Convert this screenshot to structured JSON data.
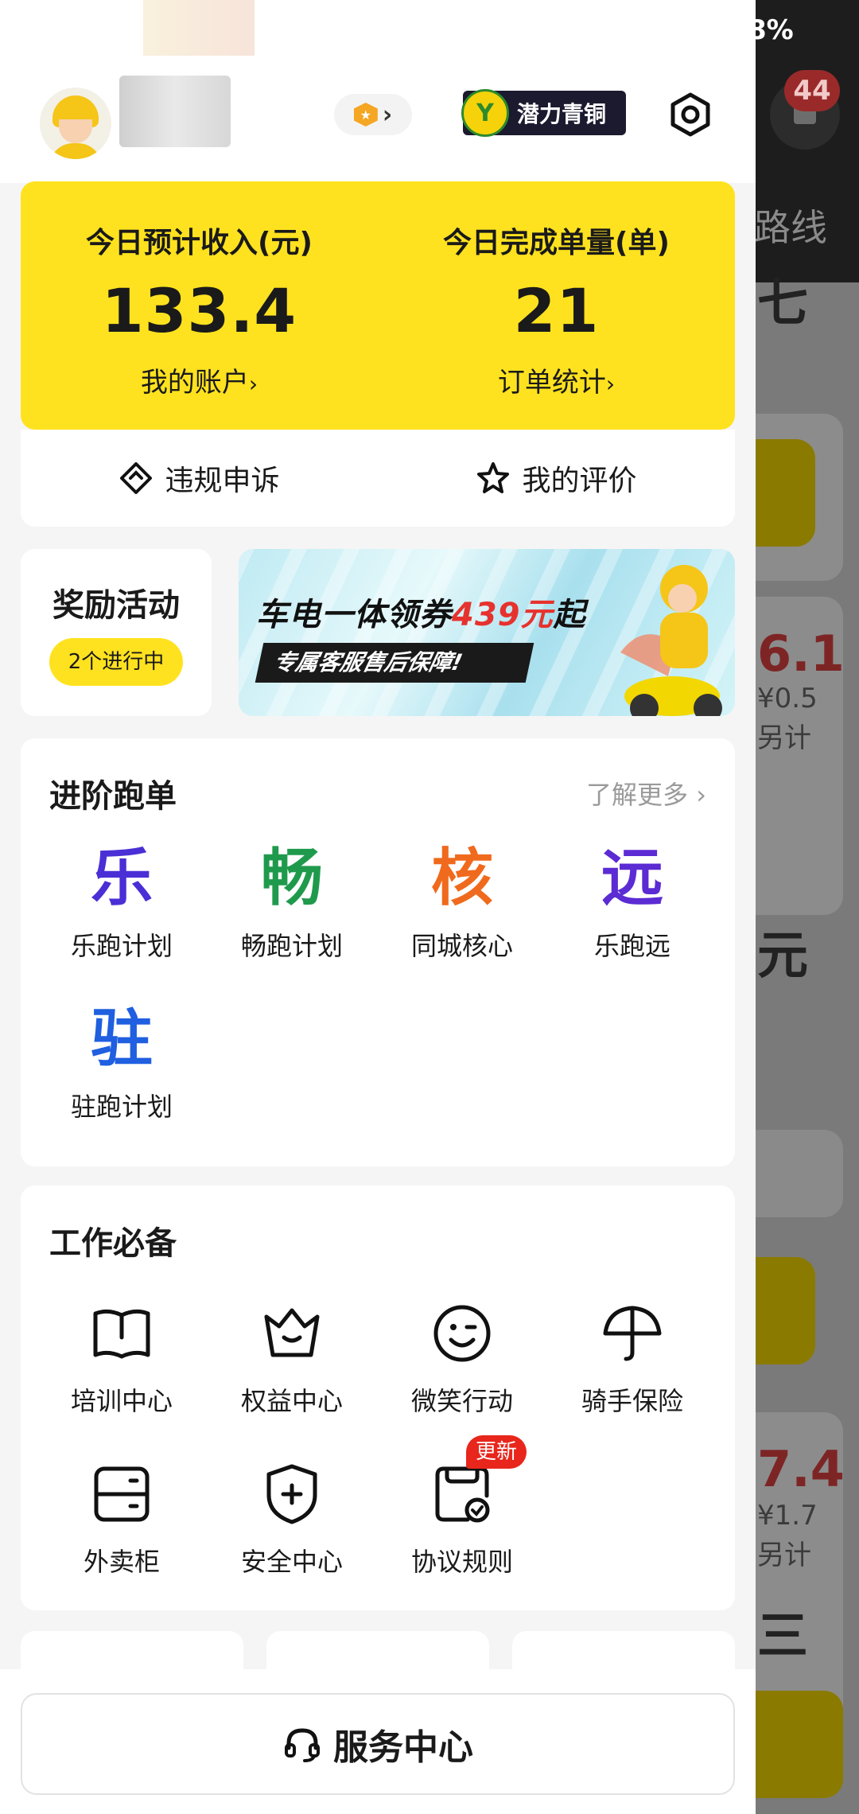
{
  "background": {
    "battery_text": "8%",
    "bell_badge": "44",
    "route_text": "路线",
    "snippets": [
      "七",
      "6.1",
      "¥0.5",
      "另计",
      "元",
      "7.4",
      "¥1.7",
      "另计",
      "三"
    ]
  },
  "header": {
    "potential_label": "潜力青铜"
  },
  "earnings": {
    "income_label": "今日预计收入(元)",
    "income_value": "133.4",
    "account_link": "我的账户",
    "orders_label": "今日完成单量(单)",
    "orders_value": "21",
    "orders_link": "订单统计",
    "arrow": "›"
  },
  "quick": {
    "appeal": "违规申诉",
    "review": "我的评价"
  },
  "rewards": {
    "title": "奖励活动",
    "status": "2个进行中"
  },
  "banner": {
    "headline_pre": "车电一体领券",
    "headline_num": "439元",
    "headline_post": "起",
    "sub": "专属客服售后保障!"
  },
  "advanced": {
    "title": "进阶跑单",
    "more": "了解更多 ›",
    "items": [
      {
        "glyph": "乐",
        "label": "乐跑计划",
        "color": "#4a2fd6"
      },
      {
        "glyph": "畅",
        "label": "畅跑计划",
        "color": "#1f9a4c"
      },
      {
        "glyph": "核",
        "label": "同城核心",
        "color": "#f06a1d"
      },
      {
        "glyph": "远",
        "label": "乐跑远",
        "color": "#5b2bd3"
      },
      {
        "glyph": "驻",
        "label": "驻跑计划",
        "color": "#1f5fe0"
      }
    ]
  },
  "essentials": {
    "title": "工作必备",
    "items": [
      {
        "label": "培训中心",
        "icon": "book-icon"
      },
      {
        "label": "权益中心",
        "icon": "crown-icon"
      },
      {
        "label": "微笑行动",
        "icon": "smile-icon"
      },
      {
        "label": "骑手保险",
        "icon": "umbrella-icon"
      },
      {
        "label": "外卖柜",
        "icon": "locker-icon"
      },
      {
        "label": "安全中心",
        "icon": "shield-icon"
      },
      {
        "label": "协议规则",
        "icon": "agreement-icon",
        "badge": "更新"
      }
    ]
  },
  "service": {
    "label": "服务中心"
  }
}
